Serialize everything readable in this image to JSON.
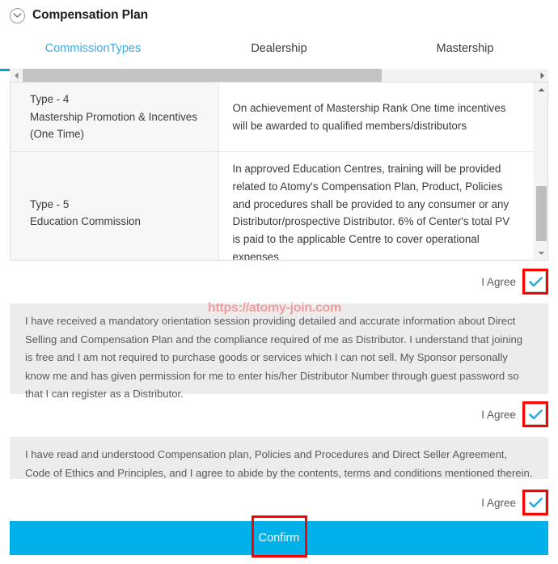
{
  "header": {
    "title": "Compensation Plan",
    "collapse_icon": "chevron-down-circle-icon"
  },
  "tabs": [
    {
      "label": "CommissionTypes",
      "active": true
    },
    {
      "label": "Dealership",
      "active": false
    },
    {
      "label": "Mastership",
      "active": false
    }
  ],
  "scrollbars": {
    "horizontal": {
      "left_arrow": "◀",
      "right_arrow": "▶",
      "thumb_percent": 70
    },
    "vertical": {
      "up_arrow": "▲",
      "down_arrow": "▼"
    }
  },
  "commission_table": {
    "rows": [
      {
        "type": "Type - 4\nMastership Promotion & Incentives\n(One Time)",
        "type_lines": [
          "Type - 4",
          "Mastership Promotion & Incentives",
          "(One Time)"
        ],
        "description": "On achievement of Mastership Rank One time incentives will be awarded to qualified members/distributors"
      },
      {
        "type": "Type - 5\nEducation Commission",
        "type_lines": [
          "Type - 5",
          "Education Commission"
        ],
        "description": "In approved Education Centres, training will be provided related to Atomy's Compensation Plan, Product, Policies and procedures shall be provided to any consumer or any Distributor/prospective Distributor. 6% of Center's total PV is paid to the applicable Centre to cover operational expenses"
      }
    ]
  },
  "agreements": [
    {
      "agree_label": "I Agree",
      "checked": true,
      "checkbox_highlighted": true
    },
    {
      "agree_label": "I Agree",
      "checked": true,
      "checkbox_highlighted": true,
      "text": "I have received a mandatory orientation session providing detailed and accurate information about Direct Selling and Compensation Plan and the compliance required of me as Distributor. I understand that joining is free and I am not required to purchase goods or services which I can not sell. My Sponsor personally know me and has given permission for me to enter his/her Distributor Number through guest password so that I can register as a Distributor."
    },
    {
      "agree_label": "I Agree",
      "checked": true,
      "checkbox_highlighted": true,
      "text": "I have read and understood Compensation plan, Policies and Procedures and Direct Seller Agreement, Code of Ethics and Principles, and I agree to abide by the contents, terms and conditions mentioned therein."
    }
  ],
  "watermark": {
    "text": "https://atomy-join.com"
  },
  "confirm": {
    "label": "Confirm",
    "highlighted": true
  },
  "colors": {
    "accent_blue": "#00a0e8",
    "tab_active": "#3fa9e5",
    "confirm_bar": "#00b0e8",
    "highlight_red": "#ff0000",
    "agreement_bg": "#ececec",
    "table_left_bg": "#f7f7f7",
    "check_blue": "#29abe2"
  }
}
